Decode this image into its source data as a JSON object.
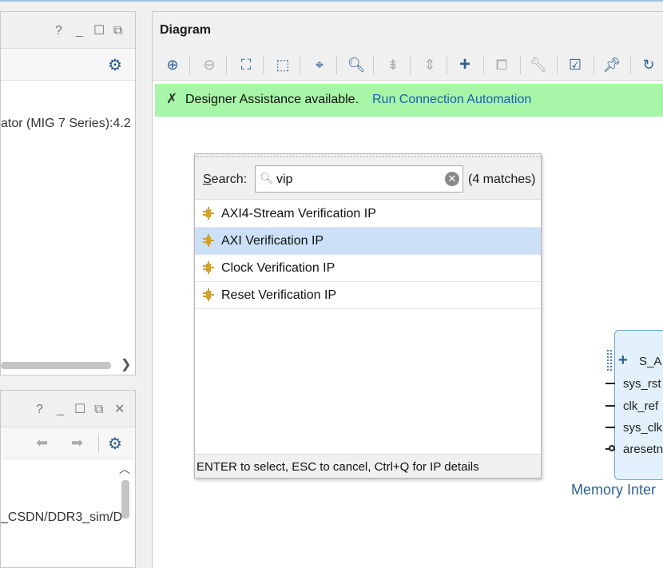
{
  "top_pane": {
    "controls": [
      "?",
      "_",
      "☐",
      "⧉"
    ],
    "row_text": "ator (MIG 7 Series):4.2"
  },
  "bottom_pane": {
    "controls": [
      "?",
      "_",
      "☐",
      "⧉",
      "✕"
    ],
    "row_text": "_CSDN/DDR3_sim/D"
  },
  "diagram": {
    "title": "Diagram",
    "assist_message": "Designer Assistance available.",
    "assist_link": "Run Connection Automation",
    "block_ports": [
      "S_A",
      "sys_rst",
      "clk_ref",
      "sys_clk",
      "aresetn"
    ],
    "block_caption": "Memory Inter"
  },
  "popup": {
    "search_label_prefix": "S",
    "search_label_rest": "earch:",
    "search_value": "vip",
    "matches": "(4 matches)",
    "results": [
      {
        "label": "AXI4-Stream Verification IP"
      },
      {
        "label": "AXI Verification IP"
      },
      {
        "label": "Clock Verification IP"
      },
      {
        "label": "Reset Verification IP"
      }
    ],
    "footer": "ENTER to select, ESC to cancel, Ctrl+Q for IP details"
  },
  "colors": {
    "accent": "#2d5f8f",
    "assist_bg": "#a7f5a7",
    "link": "#1a5fb4",
    "selected_row": "#cce0f7",
    "block_fill": "#e2f1fb",
    "ip_icon": "#d4a12a"
  },
  "icons": {
    "toolbar": [
      "zoom-in-icon",
      "zoom-out-icon",
      "zoom-fit-icon",
      "zoom-area-icon",
      "auto-fit-selection-icon",
      "search-icon",
      "collapse-icon",
      "expand-icon",
      "add-ip-icon",
      "route-icon",
      "wrench-icon",
      "validate-icon",
      "pin-icon",
      "refresh-icon"
    ]
  }
}
